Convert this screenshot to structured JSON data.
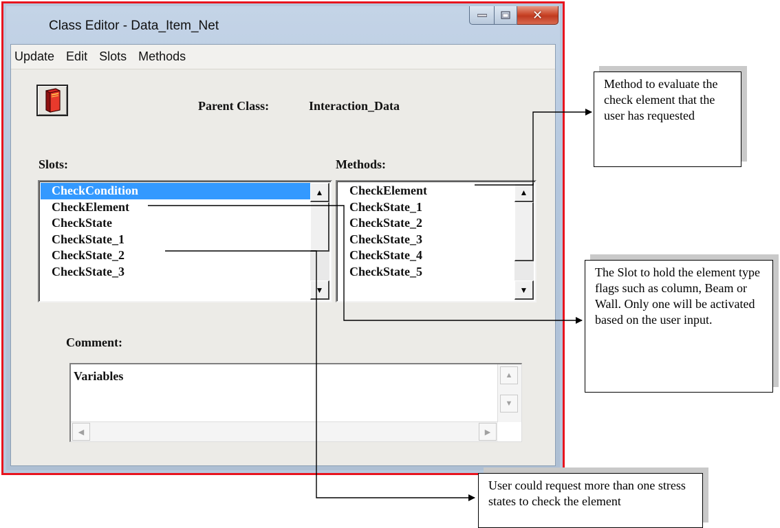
{
  "window": {
    "title": "Class Editor - Data_Item_Net"
  },
  "menu": [
    "Update",
    "Edit",
    "Slots",
    "Methods"
  ],
  "parent_class": {
    "label": "Parent Class:",
    "value": "Interaction_Data"
  },
  "slots": {
    "label": "Slots:",
    "items": [
      "CheckCondition",
      "CheckElement",
      "CheckState",
      "CheckState_1",
      "CheckState_2",
      "CheckState_3"
    ],
    "selected": "CheckCondition"
  },
  "methods": {
    "label": "Methods:",
    "items": [
      "CheckElement",
      "CheckState_1",
      "CheckState_2",
      "CheckState_3",
      "CheckState_4",
      "CheckState_5"
    ]
  },
  "comment": {
    "label": "Comment:",
    "text": "Variables"
  },
  "callouts": {
    "method": "Method to evaluate the check element that the user has requested",
    "slot": "The Slot to hold the element type flags such as column, Beam or Wall. Only one will be activated based on the user input.",
    "user": "User could request more than one stress states to check the element"
  }
}
